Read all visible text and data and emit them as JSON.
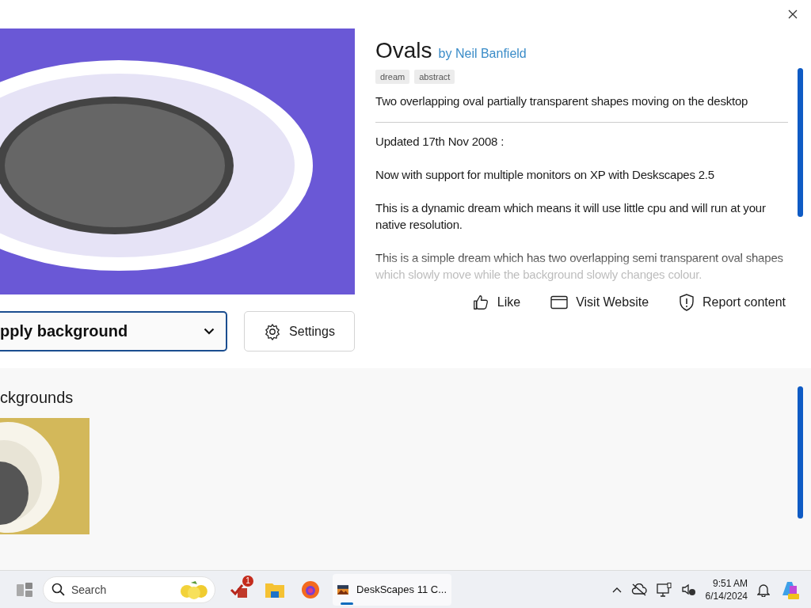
{
  "details": {
    "title": "Ovals",
    "author": "by Neil Banfield",
    "tags": [
      "dream",
      "abstract"
    ],
    "summary": "Two overlapping oval partially transparent shapes moving on the desktop",
    "description": [
      "Updated 17th Nov 2008 :",
      "Now with support for multiple monitors on XP with Deskscapes 2.5",
      "This is a dynamic dream which means it will use little cpu and will run at your native resolution.",
      "This is a simple dream which has two overlapping semi transparent oval shapes which slowly move while the background slowly changes colour."
    ]
  },
  "actions": {
    "apply": "pply background",
    "settings": "Settings"
  },
  "links": [
    {
      "kind": "like",
      "label": "Like"
    },
    {
      "kind": "website",
      "label": "Visit Website"
    },
    {
      "kind": "report",
      "label": "Report content"
    }
  ],
  "related": {
    "heading": "ckgrounds"
  },
  "taskbar": {
    "search_placeholder": "Search",
    "badge": "1",
    "app": {
      "label": "DeskScapes 11 C...",
      "active": true
    },
    "time": "9:51 AM",
    "date": "6/14/2024"
  }
}
